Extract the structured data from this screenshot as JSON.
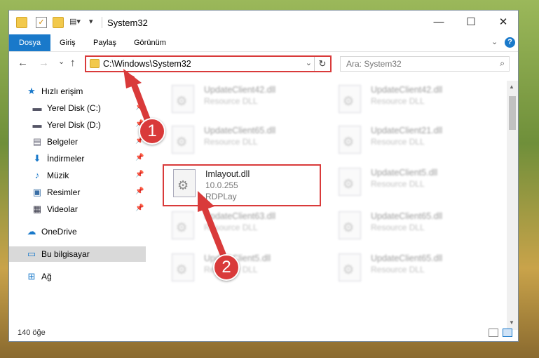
{
  "window": {
    "title": "System32"
  },
  "titlebar_buttons": {
    "minimize": "—",
    "maximize": "☐",
    "close": "✕"
  },
  "ribbon": {
    "tabs": [
      "Dosya",
      "Giriş",
      "Paylaş",
      "Görünüm"
    ],
    "active_tab": "Dosya",
    "collapse_icon": "chevron-down-icon",
    "help_label": "?"
  },
  "navigation": {
    "back": "←",
    "forward": "→",
    "recent": "⌄",
    "up": "↑",
    "address": "C:\\Windows\\System32",
    "search_placeholder": "Ara: System32"
  },
  "sidebar": {
    "items": [
      {
        "label": "Hızlı erişim",
        "icon": "star-icon"
      },
      {
        "label": "Yerel Disk (C:)",
        "icon": "disk-icon",
        "pinned": true
      },
      {
        "label": "Yerel Disk (D:)",
        "icon": "disk-icon",
        "pinned": true
      },
      {
        "label": "Belgeler",
        "icon": "document-icon",
        "pinned": true
      },
      {
        "label": "İndirmeler",
        "icon": "download-icon",
        "pinned": true
      },
      {
        "label": "Müzik",
        "icon": "music-icon",
        "pinned": true
      },
      {
        "label": "Resimler",
        "icon": "picture-icon",
        "pinned": true
      },
      {
        "label": "Videolar",
        "icon": "video-icon",
        "pinned": true
      },
      {
        "label": "OneDrive",
        "icon": "cloud-icon"
      },
      {
        "label": "Bu bilgisayar",
        "icon": "computer-icon",
        "selected": true
      },
      {
        "label": "Ağ",
        "icon": "network-icon"
      }
    ]
  },
  "files": {
    "left": [
      {
        "name": "UpdateClient42.dll",
        "sub": "Resource DLL"
      },
      {
        "name": "UpdateClient65.dll",
        "sub": "Resource DLL"
      },
      {
        "name": "UpdateClient63.dll",
        "sub": "Resource DLL"
      },
      {
        "name": "UpdateClient5.dll",
        "sub": "Resource DLL"
      }
    ],
    "right": [
      {
        "name": "UpdateClient42.dll",
        "sub": "Resource DLL"
      },
      {
        "name": "UpdateClient21.dll",
        "sub": "Resource DLL"
      },
      {
        "name": "UpdateClient5.dll",
        "sub": "Resource DLL"
      },
      {
        "name": "UpdateClient65.dll",
        "sub": "Resource DLL"
      },
      {
        "name": "UpdateClient65.dll",
        "sub": "Resource DLL"
      }
    ],
    "highlighted": {
      "name": "Imlayout.dll",
      "version": "10.0.255",
      "company": "RDPLay"
    }
  },
  "status": {
    "count": "140 öğe"
  },
  "callouts": [
    "1",
    "2"
  ],
  "colors": {
    "accent": "#1979ca",
    "highlight": "#d93a3a"
  }
}
